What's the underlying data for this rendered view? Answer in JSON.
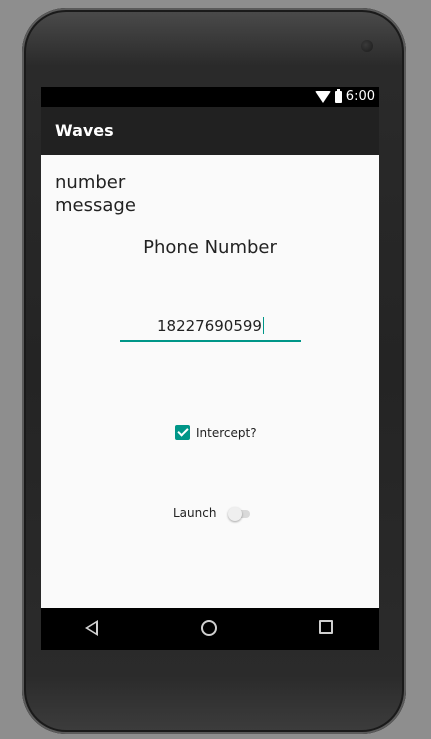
{
  "status_bar": {
    "time": "6:00"
  },
  "app_bar": {
    "title": "Waves"
  },
  "main": {
    "header_line1": "number",
    "header_line2": "message",
    "phone_label": "Phone Number",
    "phone_input_value": "18227690599",
    "intercept_label": "Intercept?",
    "intercept_checked": true,
    "launch_label": "Launch",
    "launch_on": false
  },
  "colors": {
    "accent": "#009688",
    "app_bar": "#212121",
    "background": "#fafafa"
  },
  "icons": {
    "wifi": "wifi-icon",
    "battery": "battery-icon",
    "back": "back-icon",
    "home": "home-icon",
    "recents": "recents-icon"
  }
}
